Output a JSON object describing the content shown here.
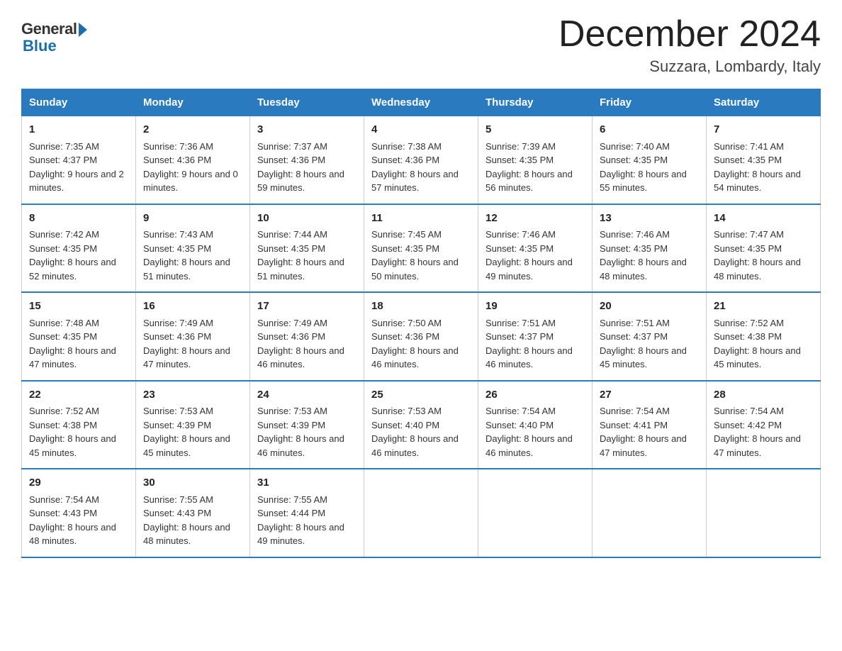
{
  "logo": {
    "general": "General",
    "blue": "Blue"
  },
  "title": "December 2024",
  "subtitle": "Suzzara, Lombardy, Italy",
  "days_of_week": [
    "Sunday",
    "Monday",
    "Tuesday",
    "Wednesday",
    "Thursday",
    "Friday",
    "Saturday"
  ],
  "weeks": [
    [
      {
        "day": "1",
        "sunrise": "7:35 AM",
        "sunset": "4:37 PM",
        "daylight": "9 hours and 2 minutes."
      },
      {
        "day": "2",
        "sunrise": "7:36 AM",
        "sunset": "4:36 PM",
        "daylight": "9 hours and 0 minutes."
      },
      {
        "day": "3",
        "sunrise": "7:37 AM",
        "sunset": "4:36 PM",
        "daylight": "8 hours and 59 minutes."
      },
      {
        "day": "4",
        "sunrise": "7:38 AM",
        "sunset": "4:36 PM",
        "daylight": "8 hours and 57 minutes."
      },
      {
        "day": "5",
        "sunrise": "7:39 AM",
        "sunset": "4:35 PM",
        "daylight": "8 hours and 56 minutes."
      },
      {
        "day": "6",
        "sunrise": "7:40 AM",
        "sunset": "4:35 PM",
        "daylight": "8 hours and 55 minutes."
      },
      {
        "day": "7",
        "sunrise": "7:41 AM",
        "sunset": "4:35 PM",
        "daylight": "8 hours and 54 minutes."
      }
    ],
    [
      {
        "day": "8",
        "sunrise": "7:42 AM",
        "sunset": "4:35 PM",
        "daylight": "8 hours and 52 minutes."
      },
      {
        "day": "9",
        "sunrise": "7:43 AM",
        "sunset": "4:35 PM",
        "daylight": "8 hours and 51 minutes."
      },
      {
        "day": "10",
        "sunrise": "7:44 AM",
        "sunset": "4:35 PM",
        "daylight": "8 hours and 51 minutes."
      },
      {
        "day": "11",
        "sunrise": "7:45 AM",
        "sunset": "4:35 PM",
        "daylight": "8 hours and 50 minutes."
      },
      {
        "day": "12",
        "sunrise": "7:46 AM",
        "sunset": "4:35 PM",
        "daylight": "8 hours and 49 minutes."
      },
      {
        "day": "13",
        "sunrise": "7:46 AM",
        "sunset": "4:35 PM",
        "daylight": "8 hours and 48 minutes."
      },
      {
        "day": "14",
        "sunrise": "7:47 AM",
        "sunset": "4:35 PM",
        "daylight": "8 hours and 48 minutes."
      }
    ],
    [
      {
        "day": "15",
        "sunrise": "7:48 AM",
        "sunset": "4:35 PM",
        "daylight": "8 hours and 47 minutes."
      },
      {
        "day": "16",
        "sunrise": "7:49 AM",
        "sunset": "4:36 PM",
        "daylight": "8 hours and 47 minutes."
      },
      {
        "day": "17",
        "sunrise": "7:49 AM",
        "sunset": "4:36 PM",
        "daylight": "8 hours and 46 minutes."
      },
      {
        "day": "18",
        "sunrise": "7:50 AM",
        "sunset": "4:36 PM",
        "daylight": "8 hours and 46 minutes."
      },
      {
        "day": "19",
        "sunrise": "7:51 AM",
        "sunset": "4:37 PM",
        "daylight": "8 hours and 46 minutes."
      },
      {
        "day": "20",
        "sunrise": "7:51 AM",
        "sunset": "4:37 PM",
        "daylight": "8 hours and 45 minutes."
      },
      {
        "day": "21",
        "sunrise": "7:52 AM",
        "sunset": "4:38 PM",
        "daylight": "8 hours and 45 minutes."
      }
    ],
    [
      {
        "day": "22",
        "sunrise": "7:52 AM",
        "sunset": "4:38 PM",
        "daylight": "8 hours and 45 minutes."
      },
      {
        "day": "23",
        "sunrise": "7:53 AM",
        "sunset": "4:39 PM",
        "daylight": "8 hours and 45 minutes."
      },
      {
        "day": "24",
        "sunrise": "7:53 AM",
        "sunset": "4:39 PM",
        "daylight": "8 hours and 46 minutes."
      },
      {
        "day": "25",
        "sunrise": "7:53 AM",
        "sunset": "4:40 PM",
        "daylight": "8 hours and 46 minutes."
      },
      {
        "day": "26",
        "sunrise": "7:54 AM",
        "sunset": "4:40 PM",
        "daylight": "8 hours and 46 minutes."
      },
      {
        "day": "27",
        "sunrise": "7:54 AM",
        "sunset": "4:41 PM",
        "daylight": "8 hours and 47 minutes."
      },
      {
        "day": "28",
        "sunrise": "7:54 AM",
        "sunset": "4:42 PM",
        "daylight": "8 hours and 47 minutes."
      }
    ],
    [
      {
        "day": "29",
        "sunrise": "7:54 AM",
        "sunset": "4:43 PM",
        "daylight": "8 hours and 48 minutes."
      },
      {
        "day": "30",
        "sunrise": "7:55 AM",
        "sunset": "4:43 PM",
        "daylight": "8 hours and 48 minutes."
      },
      {
        "day": "31",
        "sunrise": "7:55 AM",
        "sunset": "4:44 PM",
        "daylight": "8 hours and 49 minutes."
      },
      null,
      null,
      null,
      null
    ]
  ]
}
